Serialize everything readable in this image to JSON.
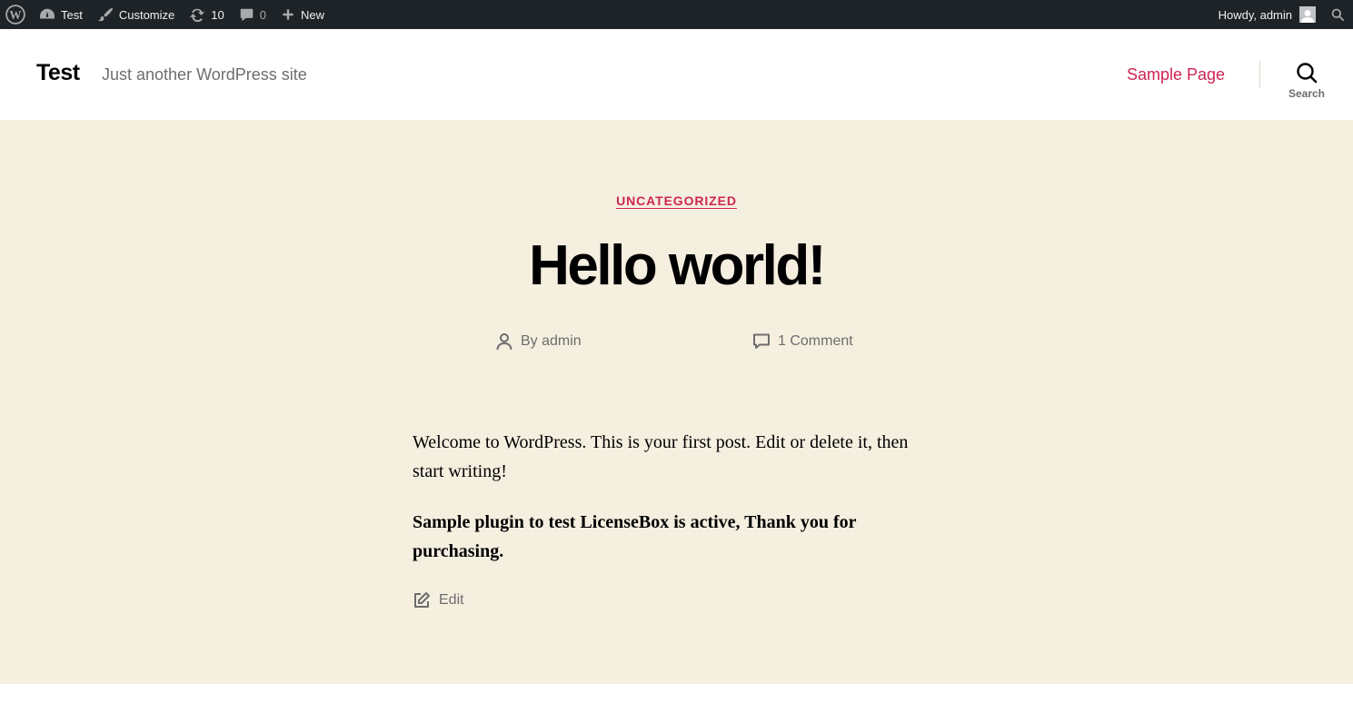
{
  "adminbar": {
    "site_name": "Test",
    "customize": "Customize",
    "updates_count": "10",
    "comments_count": "0",
    "new_label": "New",
    "greeting": "Howdy, admin",
    "bg_color": "#1d2327"
  },
  "header": {
    "site_title": "Test",
    "site_description": "Just another WordPress site",
    "menu": [
      {
        "label": "Sample Page"
      }
    ],
    "search_label": "Search",
    "accent_color": "#cd2653"
  },
  "post": {
    "category": "UNCATEGORIZED",
    "title": "Hello world!",
    "author": "By admin",
    "comments": "1 Comment",
    "paragraphs": [
      "Welcome to WordPress. This is your first post. Edit or delete it, then start writing!",
      "Sample plugin to test LicenseBox is active, Thank you for purchasing."
    ],
    "edit_label": "Edit",
    "bg_color": "#f5efe0"
  },
  "icons": {
    "wp": "wordpress-logo-icon",
    "dashboard": "dashboard-icon",
    "customize": "paintbrush-icon",
    "updates": "updates-icon",
    "comments": "comment-bubble-icon",
    "new": "plus-icon",
    "avatar": "avatar-icon",
    "adminbar_search": "search-icon",
    "author": "user-icon",
    "post_comments": "comment-icon",
    "edit": "edit-icon"
  }
}
